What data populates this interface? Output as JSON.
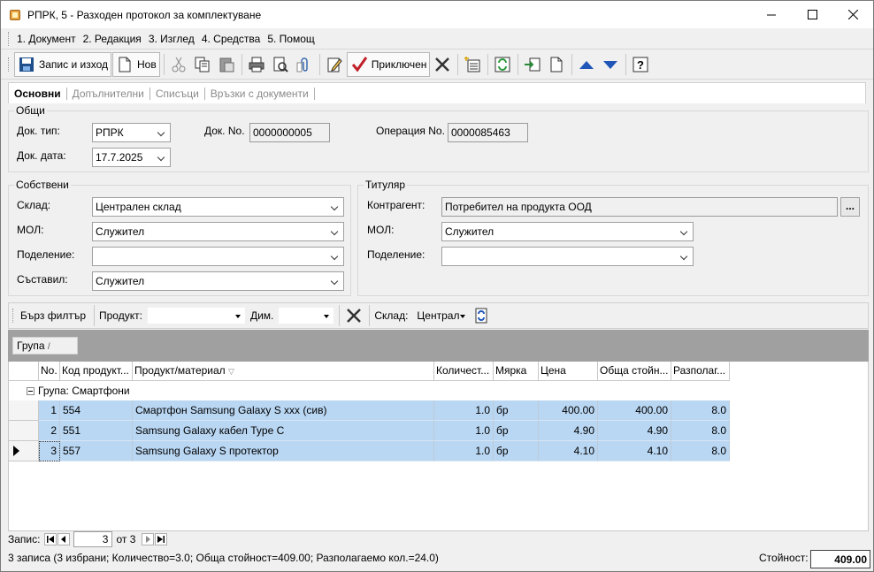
{
  "window": {
    "title": "РПРК, 5 - Разходен протокол за комплектуване"
  },
  "menu": [
    "1. Документ",
    "2. Редакция",
    "3. Изглед",
    "4. Средства",
    "5. Помощ"
  ],
  "toolbar": {
    "save_exit": "Запис и изход",
    "new": "Нов",
    "done": "Приключен"
  },
  "tabs": [
    "Основни",
    "Допълнителни",
    "Списъци",
    "Връзки с документи"
  ],
  "general": {
    "title": "Общи",
    "doc_type_label": "Док. тип:",
    "doc_type": "РПРК",
    "doc_no_label": "Док. No.",
    "doc_no": "0000000005",
    "op_no_label": "Операция No.",
    "op_no": "0000085463",
    "doc_date_label": "Док. дата:",
    "doc_date": "17.7.2025"
  },
  "own": {
    "title": "Собствени",
    "warehouse_label": "Склад:",
    "warehouse": "Централен склад",
    "mol_label": "МОЛ:",
    "mol": "Служител",
    "division_label": "Поделение:",
    "division": "",
    "author_label": "Съставил:",
    "author": "Служител"
  },
  "holder": {
    "title": "Титуляр",
    "partner_label": "Контрагент:",
    "partner": "Потребител на продукта ООД",
    "mol_label": "МОЛ:",
    "mol": "Служител",
    "division_label": "Поделение:",
    "division": ""
  },
  "filter": {
    "quick": "Бърз филтър",
    "product_label": "Продукт:",
    "dim_label": "Дим.",
    "warehouse_label": "Склад:",
    "warehouse": "Централ"
  },
  "grouping": {
    "chip": "Група"
  },
  "grid": {
    "columns": [
      "No.",
      "Код продукт...",
      "Продукт/материал",
      "Количест...",
      "Мярка",
      "Цена",
      "Обща стойн...",
      "Разполаг..."
    ],
    "group_label": "Група: Смартфони",
    "rows": [
      {
        "no": "1",
        "code": "554",
        "name": "Смартфон Samsung Galaxy S  xxx (сив)",
        "qty": "1.0",
        "unit": "бр",
        "price": "400.00",
        "total": "400.00",
        "avail": "8.0"
      },
      {
        "no": "2",
        "code": "551",
        "name": "Samsung Galaxy кабел Type C",
        "qty": "1.0",
        "unit": "бр",
        "price": "4.90",
        "total": "4.90",
        "avail": "8.0"
      },
      {
        "no": "3",
        "code": "557",
        "name": "Samsung Galaxy S протектор",
        "qty": "1.0",
        "unit": "бр",
        "price": "4.10",
        "total": "4.10",
        "avail": "8.0"
      }
    ]
  },
  "navigator": {
    "label": "Запис:",
    "current": "3",
    "of": "от 3"
  },
  "status": {
    "summary": "3 записа (3 избрани; Количество=3.0; Обща стойност=409.00; Разполагаемо кол.=24.0)",
    "total_label": "Стойност:",
    "total": "409.00"
  }
}
